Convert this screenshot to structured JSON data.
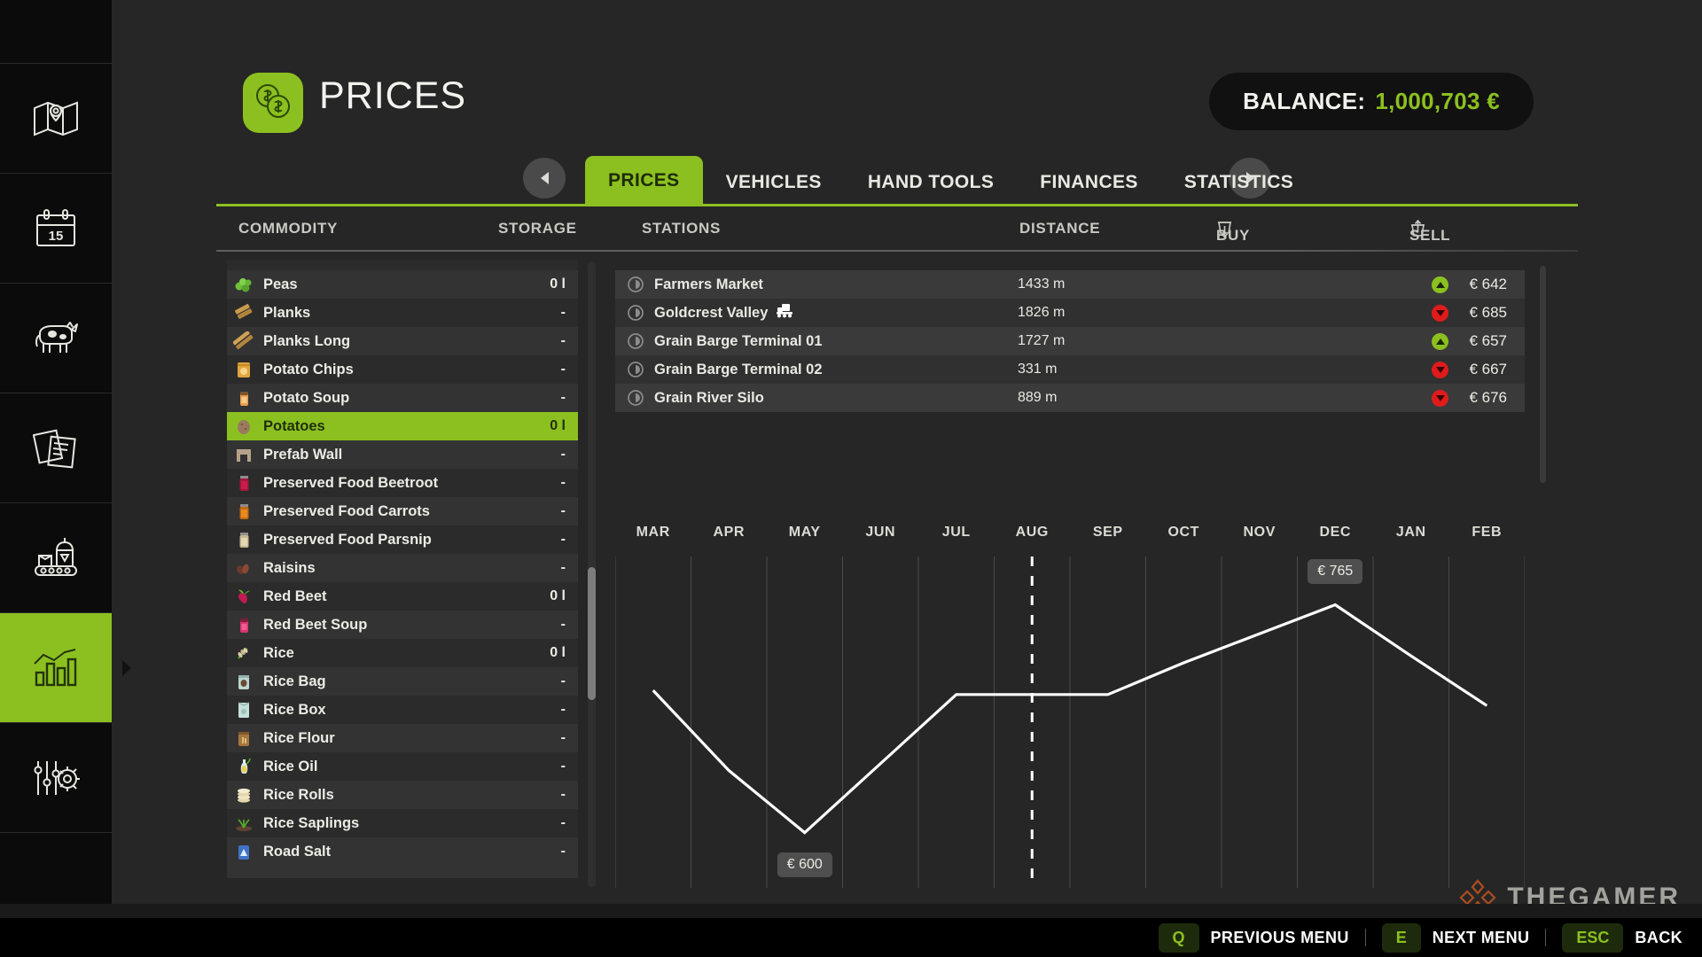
{
  "sidebar": {
    "items": [
      {
        "name": "map",
        "icon": "map-icon",
        "active": false
      },
      {
        "name": "calendar",
        "icon": "calendar-icon",
        "badge": "15",
        "active": false
      },
      {
        "name": "animals",
        "icon": "cow-icon",
        "active": false
      },
      {
        "name": "contracts",
        "icon": "documents-icon",
        "active": false
      },
      {
        "name": "production",
        "icon": "production-conveyor-icon",
        "active": false
      },
      {
        "name": "statistics",
        "icon": "bar-chart-icon",
        "active": true
      },
      {
        "name": "settings",
        "icon": "sliders-gear-icon",
        "active": false
      }
    ]
  },
  "header": {
    "title": "PRICES",
    "icon": "coins-icon",
    "balance_label": "BALANCE:",
    "balance_value": "1,000,703 €",
    "accent_color": "#8cc020"
  },
  "tabs": {
    "prev_arrow": "◄",
    "next_arrow": "►",
    "items": [
      {
        "label": "PRICES",
        "active": true
      },
      {
        "label": "VEHICLES",
        "active": false
      },
      {
        "label": "HAND TOOLS",
        "active": false
      },
      {
        "label": "FINANCES",
        "active": false
      },
      {
        "label": "STATISTICS",
        "active": false
      }
    ]
  },
  "columns": {
    "commodity": "COMMODITY",
    "storage": "STORAGE",
    "stations": "STATIONS",
    "distance": "DISTANCE",
    "buy": "BUY",
    "sell": "SELL"
  },
  "commodities": [
    {
      "name": "Peas",
      "qty": "0 l",
      "icon": "peas-icon",
      "selected": false
    },
    {
      "name": "Planks",
      "qty": "-",
      "icon": "planks-icon",
      "selected": false
    },
    {
      "name": "Planks Long",
      "qty": "-",
      "icon": "planks-long-icon",
      "selected": false
    },
    {
      "name": "Potato Chips",
      "qty": "-",
      "icon": "potato-chips-icon",
      "selected": false
    },
    {
      "name": "Potato Soup",
      "qty": "-",
      "icon": "potato-soup-icon",
      "selected": false
    },
    {
      "name": "Potatoes",
      "qty": "0 l",
      "icon": "potatoes-icon",
      "selected": true
    },
    {
      "name": "Prefab Wall",
      "qty": "-",
      "icon": "prefab-wall-icon",
      "selected": false
    },
    {
      "name": "Preserved Food Beetroot",
      "qty": "-",
      "icon": "preserved-beetroot-icon",
      "selected": false
    },
    {
      "name": "Preserved Food Carrots",
      "qty": "-",
      "icon": "preserved-carrots-icon",
      "selected": false
    },
    {
      "name": "Preserved Food Parsnip",
      "qty": "-",
      "icon": "preserved-parsnip-icon",
      "selected": false
    },
    {
      "name": "Raisins",
      "qty": "-",
      "icon": "raisins-icon",
      "selected": false
    },
    {
      "name": "Red Beet",
      "qty": "0 l",
      "icon": "red-beet-icon",
      "selected": false
    },
    {
      "name": "Red Beet Soup",
      "qty": "-",
      "icon": "red-beet-soup-icon",
      "selected": false
    },
    {
      "name": "Rice",
      "qty": "0 l",
      "icon": "rice-icon",
      "selected": false
    },
    {
      "name": "Rice Bag",
      "qty": "-",
      "icon": "rice-bag-icon",
      "selected": false
    },
    {
      "name": "Rice Box",
      "qty": "-",
      "icon": "rice-box-icon",
      "selected": false
    },
    {
      "name": "Rice Flour",
      "qty": "-",
      "icon": "rice-flour-icon",
      "selected": false
    },
    {
      "name": "Rice Oil",
      "qty": "-",
      "icon": "rice-oil-icon",
      "selected": false
    },
    {
      "name": "Rice Rolls",
      "qty": "-",
      "icon": "rice-rolls-icon",
      "selected": false
    },
    {
      "name": "Rice Saplings",
      "qty": "-",
      "icon": "rice-saplings-icon",
      "selected": false
    },
    {
      "name": "Road Salt",
      "qty": "-",
      "icon": "road-salt-icon",
      "selected": false
    }
  ],
  "stations": [
    {
      "name": "Farmers Market",
      "distance": "1433 m",
      "trend": "up",
      "price": "€ 642",
      "train": false
    },
    {
      "name": "Goldcrest Valley",
      "distance": "1826 m",
      "trend": "down",
      "price": "€ 685",
      "train": true
    },
    {
      "name": "Grain Barge Terminal 01",
      "distance": "1727 m",
      "trend": "up",
      "price": "€ 657",
      "train": false
    },
    {
      "name": "Grain Barge Terminal 02",
      "distance": "331 m",
      "trend": "down",
      "price": "€ 667",
      "train": false
    },
    {
      "name": "Grain River Silo",
      "distance": "889 m",
      "trend": "down",
      "price": "€ 676",
      "train": false
    }
  ],
  "chart_data": {
    "type": "line",
    "title": "",
    "xlabel": "",
    "ylabel": "",
    "categories": [
      "MAR",
      "APR",
      "MAY",
      "JUN",
      "JUL",
      "AUG",
      "SEP",
      "OCT",
      "NOV",
      "DEC",
      "JAN",
      "FEB"
    ],
    "series": [
      {
        "name": "Potatoes price",
        "values": [
          703,
          645,
          600,
          650,
          700,
          700,
          700,
          723,
          744,
          765,
          728,
          692
        ]
      }
    ],
    "ylim": [
      560,
      800
    ],
    "grid": true,
    "legend": false,
    "current_month_marker": "AUG",
    "annotations": [
      {
        "label": "€ 600",
        "category": "MAY",
        "value": 600,
        "position": "below"
      },
      {
        "label": "€ 765",
        "category": "DEC",
        "value": 765,
        "position": "above"
      }
    ],
    "line_color": "#ffffff"
  },
  "footer": {
    "hints": [
      {
        "key": "Q",
        "label": "PREVIOUS MENU"
      },
      {
        "key": "E",
        "label": "NEXT MENU"
      },
      {
        "key": "ESC",
        "label": "BACK"
      }
    ],
    "watermark": "THEGAMER"
  }
}
